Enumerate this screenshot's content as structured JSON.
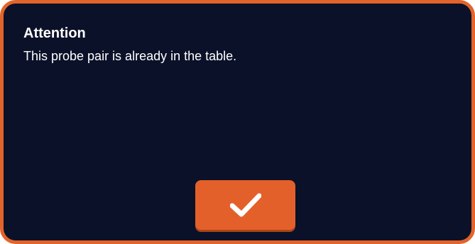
{
  "dialog": {
    "title": "Attention",
    "message": "This probe pair is already in the table.",
    "confirm_icon": "checkmark-icon"
  },
  "colors": {
    "background": "#0b1128",
    "accent": "#e4602a",
    "text": "#ffffff"
  }
}
